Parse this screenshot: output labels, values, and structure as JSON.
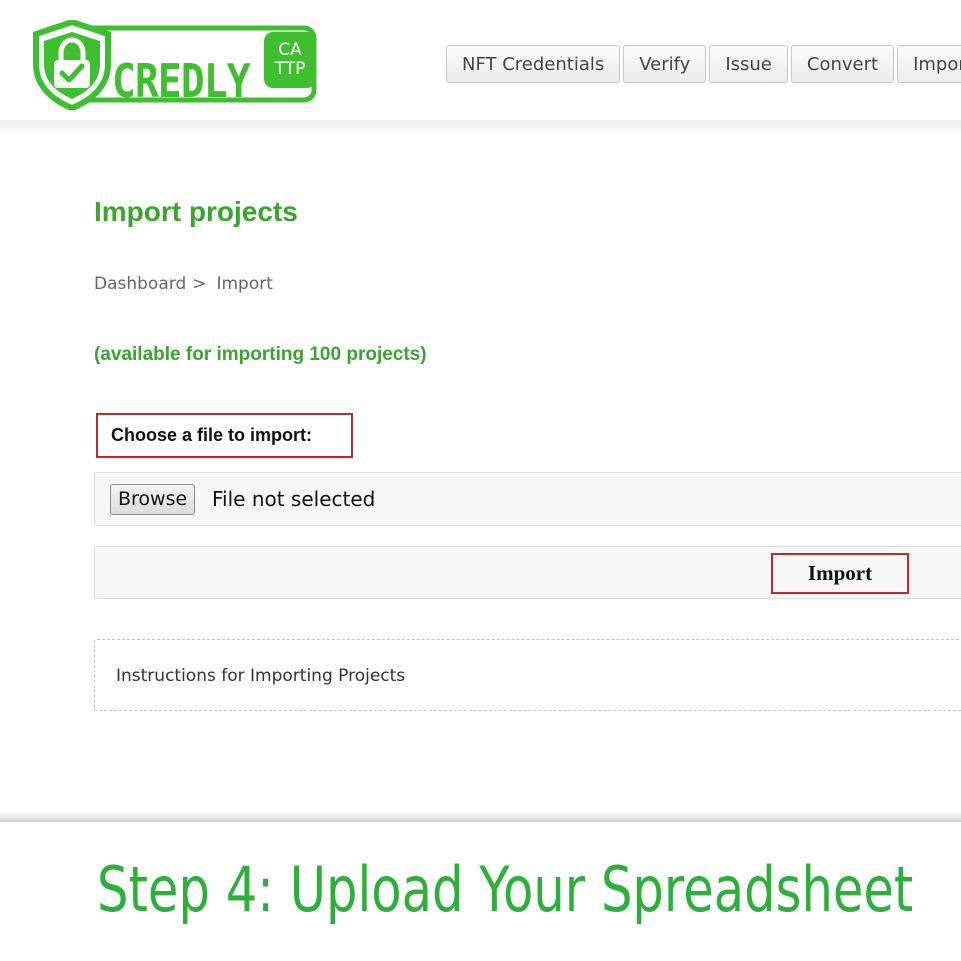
{
  "brand": {
    "name": "CREDLY",
    "badge_line1": "CA",
    "badge_line2": "TTP",
    "color": "#3fbf30"
  },
  "nav": {
    "items": [
      {
        "label": "NFT Credentials"
      },
      {
        "label": "Verify"
      },
      {
        "label": "Issue"
      },
      {
        "label": "Convert"
      },
      {
        "label": "Import"
      }
    ]
  },
  "main": {
    "title": "Import projects",
    "breadcrumb": {
      "home": "Dashboard",
      "separator": ">",
      "current": "Import"
    },
    "availability": "(available for importing 100 projects)",
    "file_label": "Choose a file to import:",
    "browse_label": "Browse",
    "file_status": "File not selected",
    "import_label": "Import",
    "instructions_label": "Instructions for Importing Projects"
  },
  "caption": {
    "text": "Step 4: Upload Your Spreadsheet",
    "color": "#2bb03a"
  },
  "colors": {
    "accent_green": "#3aa52e",
    "highlight_red": "#c0282a"
  },
  "icons": {
    "logo": "shield-lock-check-icon"
  }
}
